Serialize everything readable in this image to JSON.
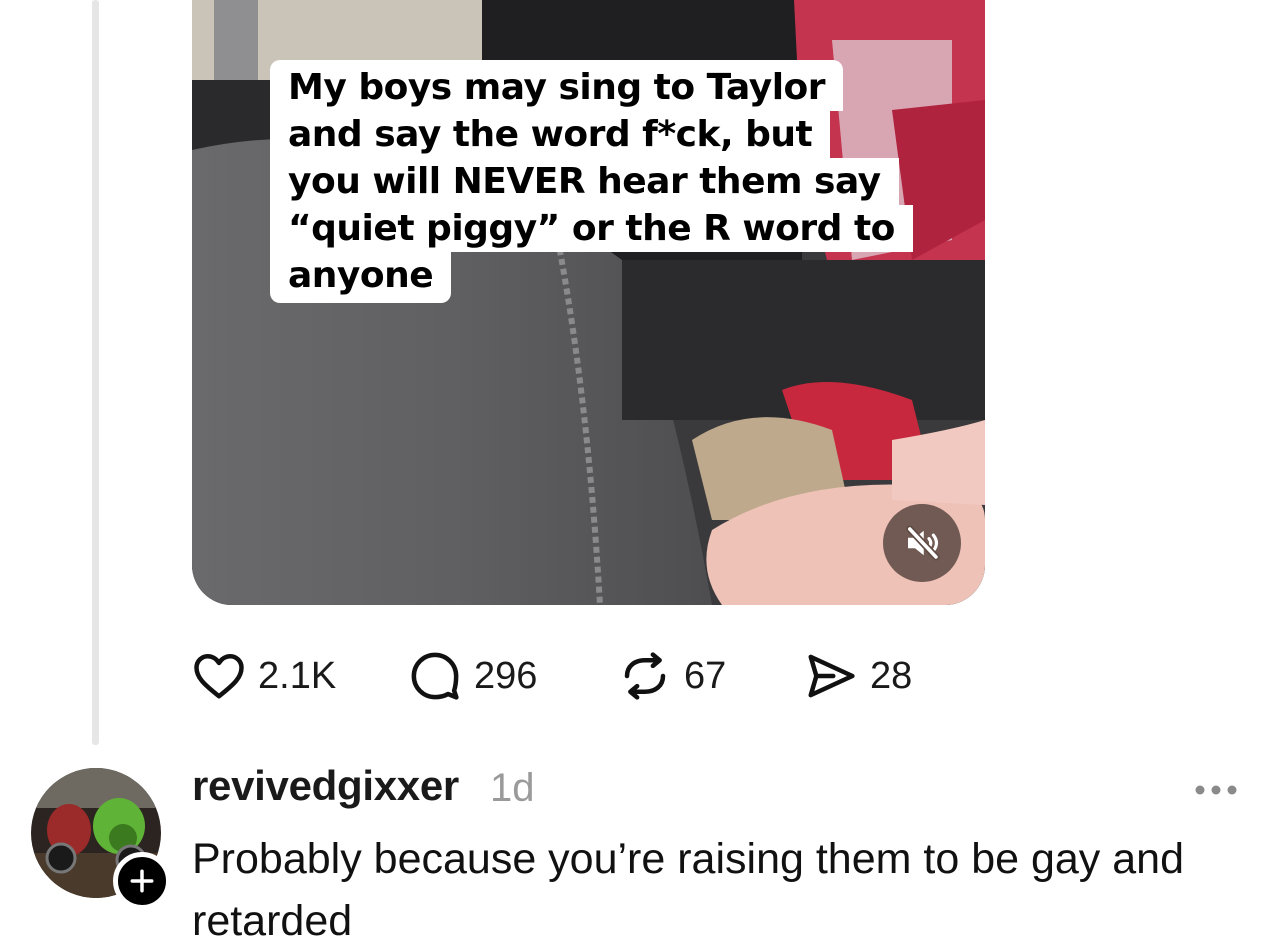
{
  "post": {
    "video": {
      "caption_lines": [
        "My boys may sing to Taylor",
        "and say the word f*ck, but",
        "you will NEVER hear them say",
        "“quiet piggy” or the R word to",
        "anyone"
      ],
      "mute_icon": "speaker-muted-icon"
    },
    "stats": {
      "likes": "2.1K",
      "comments": "296",
      "reposts": "67",
      "shares": "28"
    }
  },
  "reply": {
    "username": "revivedgixxer",
    "time": "1d",
    "text": "Probably because you’re raising them to be gay and retarded",
    "follow_icon": "plus-icon",
    "more_icon": "more-options-icon"
  }
}
